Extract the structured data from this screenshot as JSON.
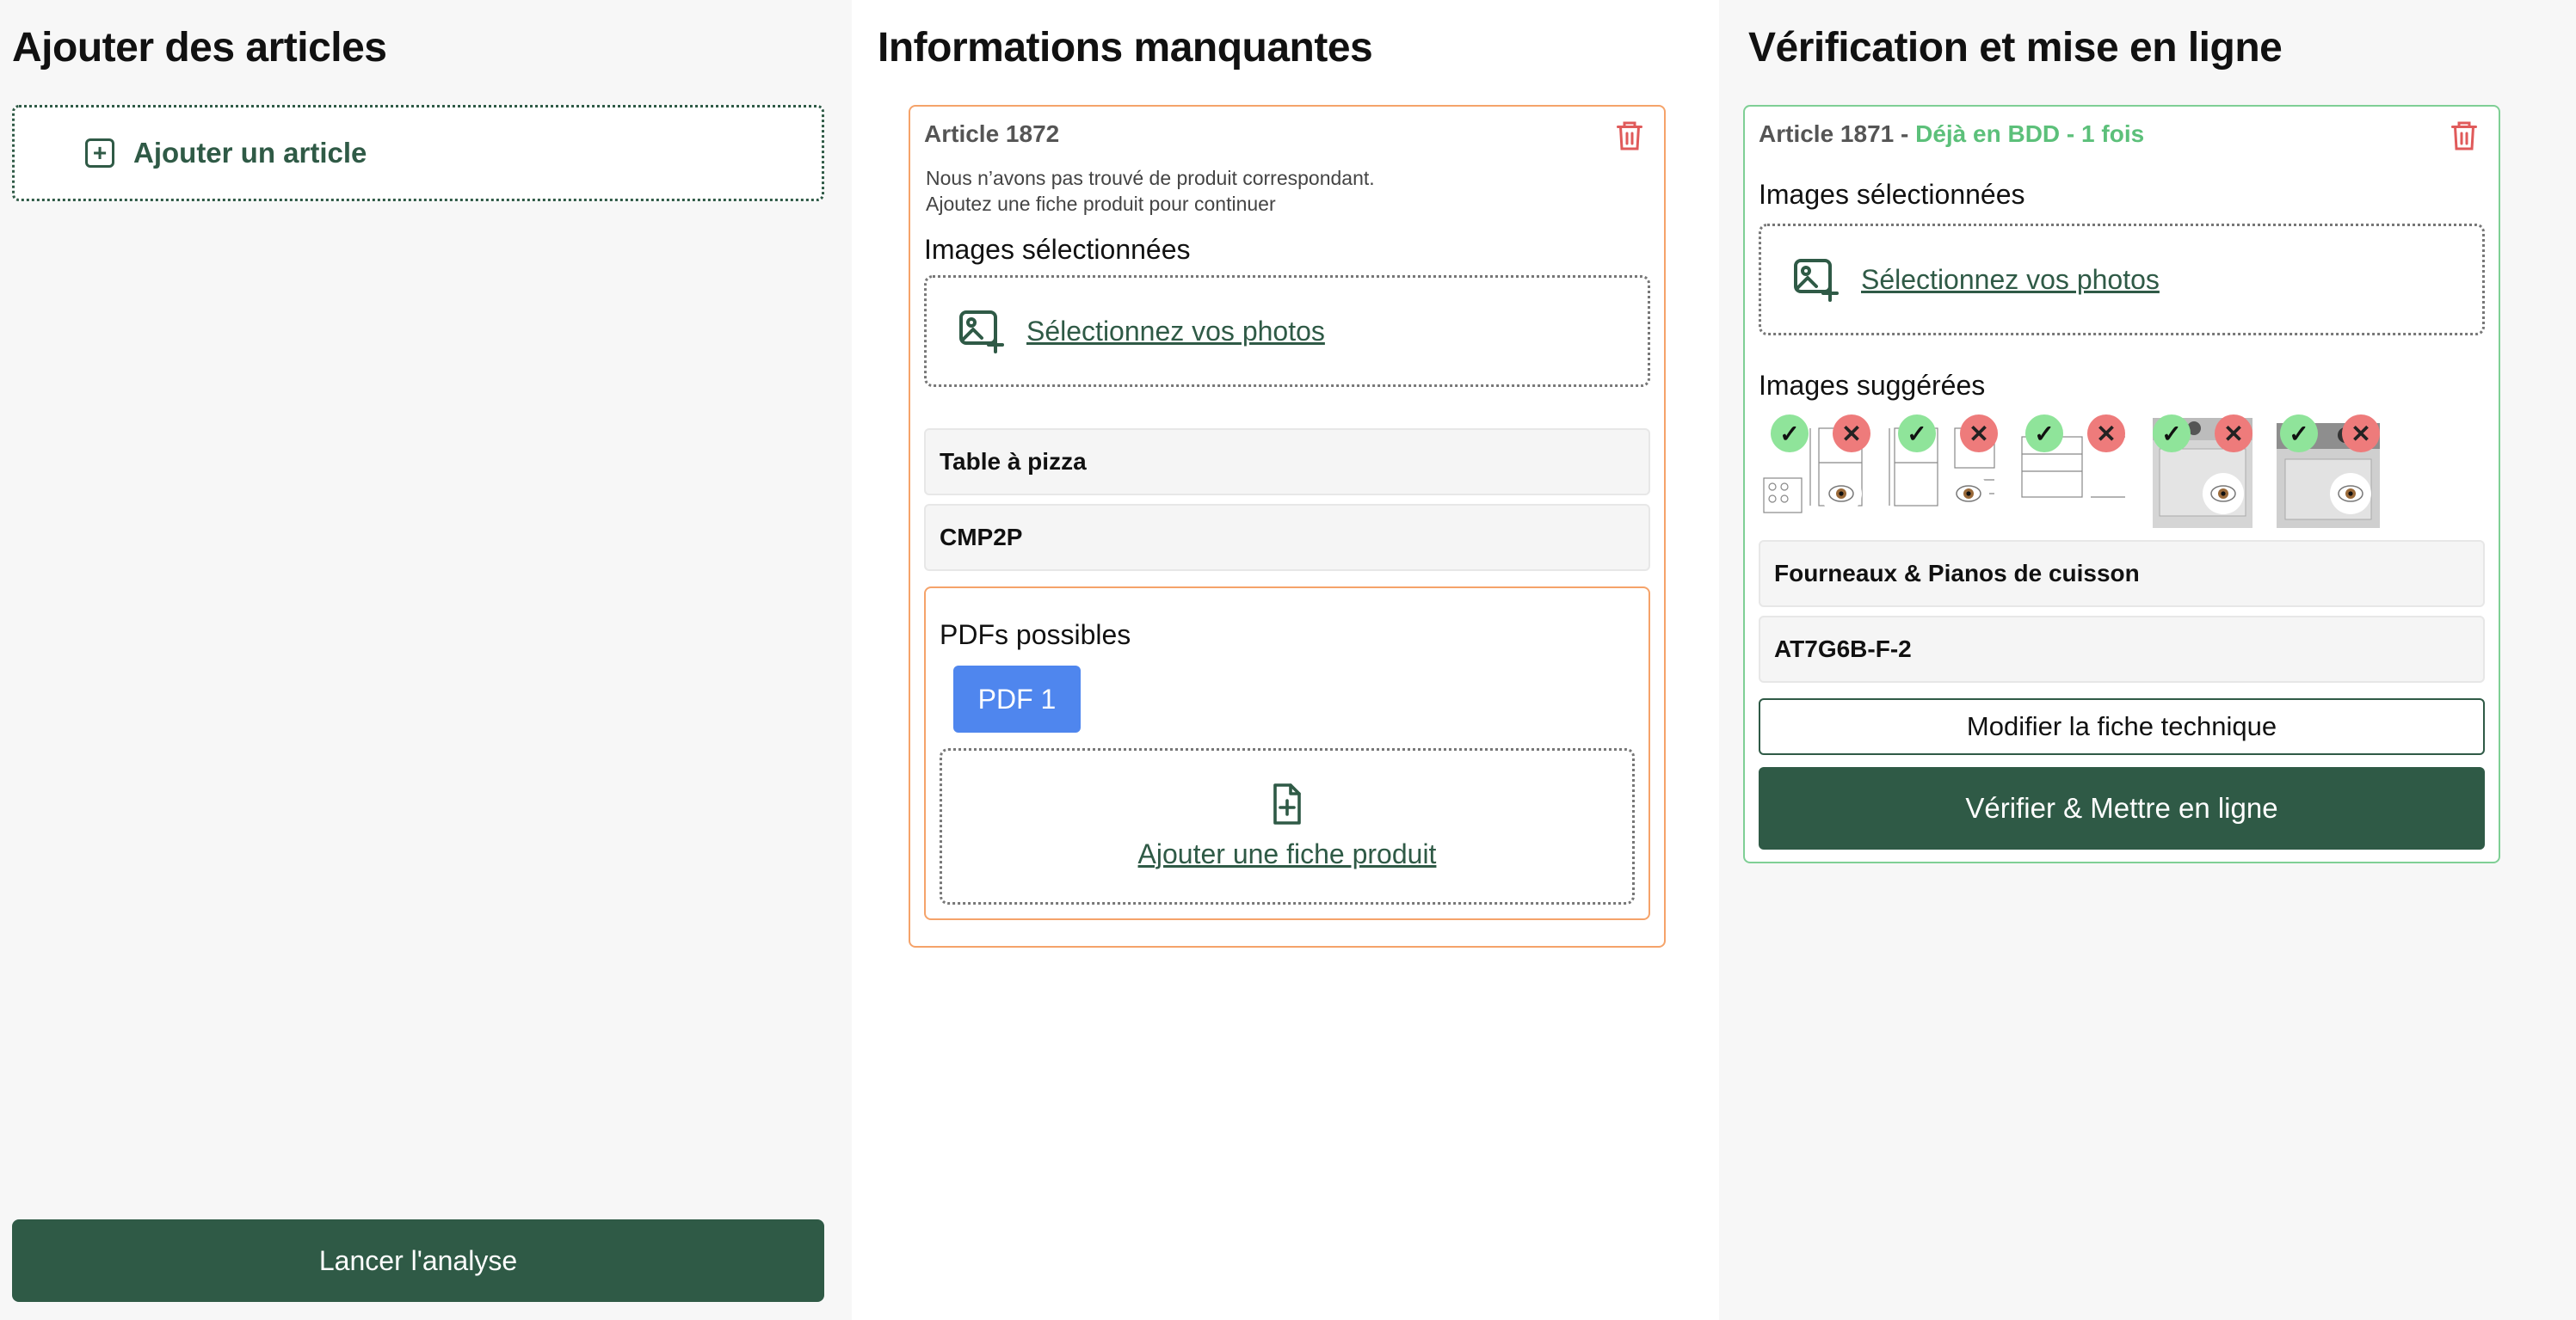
{
  "colors": {
    "brand_green": "#2f5a46",
    "warning_orange": "#f5a36a",
    "success_green": "#5cc07a",
    "danger_red": "#e05a5a",
    "pdf_blue": "#4f86ee"
  },
  "left": {
    "title": "Ajouter des articles",
    "add_article_label": "Ajouter un article",
    "launch_label": "Lancer l'analyse"
  },
  "middle": {
    "title": "Informations manquantes",
    "card": {
      "header": "Article 1872",
      "notice_line1": "Nous n’avons pas trouvé de produit correspondant.",
      "notice_line2": "Ajoutez une fiche produit pour continuer",
      "images_label": "Images sélectionnées",
      "select_photos_label": "Sélectionnez vos photos",
      "name_value": "Table à pizza",
      "reference_value": "CMP2P",
      "pdfs_label": "PDFs possibles",
      "pdf_button": "PDF 1",
      "add_sheet_label": "Ajouter une fiche produit"
    }
  },
  "right": {
    "title": "Vérification et mise en ligne",
    "card": {
      "header_article": "Article 1871 - ",
      "header_status": "Déjà en BDD - 1 fois",
      "images_label": "Images sélectionnées",
      "select_photos_label": "Sélectionnez vos photos",
      "suggested_label": "Images suggérées",
      "suggested_images": [
        {
          "kind": "technical-drawing",
          "accept_icon": "✓",
          "reject_icon": "✕"
        },
        {
          "kind": "technical-drawing",
          "accept_icon": "✓",
          "reject_icon": "✕"
        },
        {
          "kind": "technical-drawing",
          "accept_icon": "✓",
          "reject_icon": "✕"
        },
        {
          "kind": "product-photo",
          "accept_icon": "✓",
          "reject_icon": "✕"
        },
        {
          "kind": "product-photo",
          "accept_icon": "✓",
          "reject_icon": "✕"
        }
      ],
      "category_value": "Fourneaux & Pianos de cuisson",
      "reference_value": "AT7G6B-F-2",
      "edit_sheet_label": "Modifier la fiche technique",
      "publish_label": "Vérifier & Mettre en ligne"
    }
  }
}
